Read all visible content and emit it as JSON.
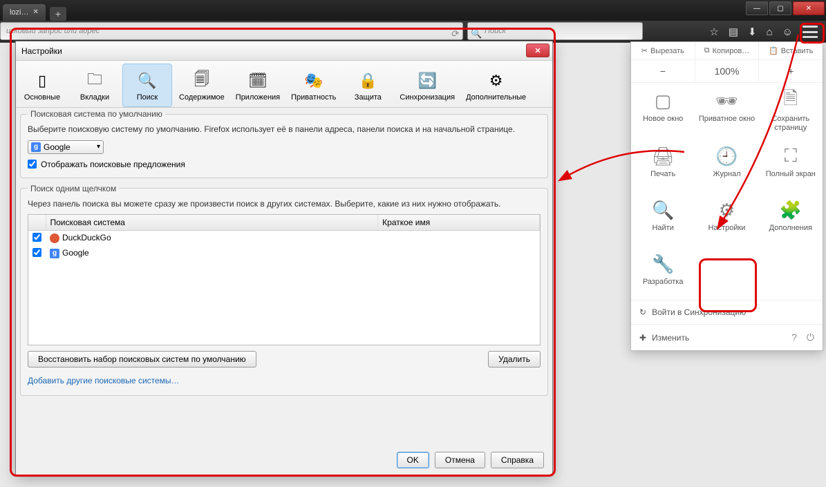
{
  "browser": {
    "tab_label": "lozi…",
    "url_placeholder": "исковый запрос или адрес",
    "search_placeholder": "Поиск"
  },
  "toolbar_icons": [
    "star-icon",
    "library-icon",
    "download-icon",
    "home-icon",
    "smile-icon",
    "menu-icon"
  ],
  "settings_dialog": {
    "title": "Настройки",
    "tabs": [
      {
        "id": "general",
        "label": "Основные"
      },
      {
        "id": "tabs",
        "label": "Вкладки"
      },
      {
        "id": "search",
        "label": "Поиск",
        "active": true
      },
      {
        "id": "content",
        "label": "Содержимое"
      },
      {
        "id": "apps",
        "label": "Приложения"
      },
      {
        "id": "privacy",
        "label": "Приватность"
      },
      {
        "id": "security",
        "label": "Защита"
      },
      {
        "id": "sync",
        "label": "Синхронизация"
      },
      {
        "id": "advanced",
        "label": "Дополнительные"
      }
    ],
    "default_engine": {
      "legend": "Поисковая система по умолчанию",
      "description": "Выберите поисковую систему по умолчанию. Firefox использует её в панели адреса, панели поиска и на начальной странице.",
      "selected": "Google",
      "show_suggestions_label": "Отображать поисковые предложения",
      "show_suggestions_checked": true
    },
    "oneclick": {
      "legend": "Поиск одним щелчком",
      "description": "Через панель поиска вы можете сразу же произвести поиск в других системах. Выберите, какие из них нужно отображать.",
      "col_engine": "Поисковая система",
      "col_short": "Краткое имя",
      "engines": [
        {
          "name": "DuckDuckGo",
          "checked": true,
          "icon": "ddg"
        },
        {
          "name": "Google",
          "checked": true,
          "icon": "g"
        }
      ],
      "restore_label": "Восстановить набор поисковых систем по умолчанию",
      "delete_label": "Удалить",
      "add_link": "Добавить другие поисковые системы…"
    },
    "footer": {
      "ok": "OK",
      "cancel": "Отмена",
      "help": "Справка"
    }
  },
  "menu_panel": {
    "edit_actions": {
      "cut": "Вырезать",
      "copy": "Копиров…",
      "paste": "Вставить"
    },
    "zoom": {
      "minus": "−",
      "value": "100%",
      "plus": "+"
    },
    "items": [
      {
        "id": "new-window",
        "label": "Новое окно"
      },
      {
        "id": "private-window",
        "label": "Приватное окно"
      },
      {
        "id": "save-page",
        "label": "Сохранить страницу"
      },
      {
        "id": "print",
        "label": "Печать"
      },
      {
        "id": "history",
        "label": "Журнал"
      },
      {
        "id": "fullscreen",
        "label": "Полный экран"
      },
      {
        "id": "find",
        "label": "Найти"
      },
      {
        "id": "settings",
        "label": "Настройки"
      },
      {
        "id": "addons",
        "label": "Дополнения"
      },
      {
        "id": "developer",
        "label": "Разработка"
      }
    ],
    "sync_login": "Войти в Синхронизацию",
    "customize": "Изменить"
  }
}
